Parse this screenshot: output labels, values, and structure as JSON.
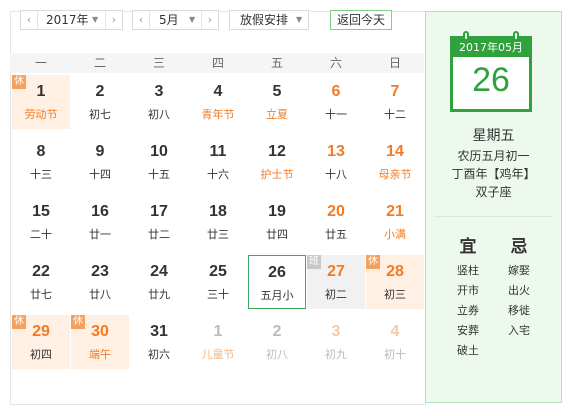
{
  "toolbar": {
    "year": "2017年",
    "month": "5月",
    "holiday_select": "放假安排",
    "today_button": "返回今天"
  },
  "weekdays": [
    "一",
    "二",
    "三",
    "四",
    "五",
    "六",
    "日"
  ],
  "days": [
    {
      "num": "1",
      "sub": "劳动节",
      "fest": true,
      "weekend": false,
      "holiday": true,
      "tag": "休"
    },
    {
      "num": "2",
      "sub": "初七"
    },
    {
      "num": "3",
      "sub": "初八"
    },
    {
      "num": "4",
      "sub": "青年节",
      "fest": true
    },
    {
      "num": "5",
      "sub": "立夏",
      "fest": true
    },
    {
      "num": "6",
      "sub": "十一",
      "weekend": true
    },
    {
      "num": "7",
      "sub": "十二",
      "weekend": true
    },
    {
      "num": "8",
      "sub": "十三"
    },
    {
      "num": "9",
      "sub": "十四"
    },
    {
      "num": "10",
      "sub": "十五"
    },
    {
      "num": "11",
      "sub": "十六"
    },
    {
      "num": "12",
      "sub": "护士节",
      "fest": true
    },
    {
      "num": "13",
      "sub": "十八",
      "weekend": true
    },
    {
      "num": "14",
      "sub": "母亲节",
      "fest": true,
      "weekend": true
    },
    {
      "num": "15",
      "sub": "二十"
    },
    {
      "num": "16",
      "sub": "廿一"
    },
    {
      "num": "17",
      "sub": "廿二"
    },
    {
      "num": "18",
      "sub": "廿三"
    },
    {
      "num": "19",
      "sub": "廿四"
    },
    {
      "num": "20",
      "sub": "廿五",
      "weekend": true
    },
    {
      "num": "21",
      "sub": "小满",
      "fest": true,
      "weekend": true
    },
    {
      "num": "22",
      "sub": "廿七"
    },
    {
      "num": "23",
      "sub": "廿八"
    },
    {
      "num": "24",
      "sub": "廿九"
    },
    {
      "num": "25",
      "sub": "三十"
    },
    {
      "num": "26",
      "sub": "五月小",
      "today": true
    },
    {
      "num": "27",
      "sub": "初二",
      "weekend": true,
      "workday": true,
      "tag": "班"
    },
    {
      "num": "28",
      "sub": "初三",
      "weekend": true,
      "holiday": true,
      "tag": "休"
    },
    {
      "num": "29",
      "sub": "初四",
      "weekend": true,
      "holiday": true,
      "tag": "休"
    },
    {
      "num": "30",
      "sub": "端午",
      "fest": true,
      "weekend": true,
      "holiday": true,
      "tag": "休"
    },
    {
      "num": "31",
      "sub": "初六"
    },
    {
      "num": "1",
      "sub": "儿童节",
      "fest": true,
      "other": true
    },
    {
      "num": "2",
      "sub": "初八",
      "other": true
    },
    {
      "num": "3",
      "sub": "初九",
      "other": true,
      "weekend": true
    },
    {
      "num": "4",
      "sub": "初十",
      "other": true,
      "weekend": true
    }
  ],
  "detail": {
    "page_header": "2017年05月",
    "page_day": "26",
    "weekday": "星期五",
    "lunar": "农历五月初一",
    "ganzhi": "丁酉年【鸡年】",
    "zodiac": "双子座",
    "yi_label": "宜",
    "ji_label": "忌",
    "yi": [
      "竖柱",
      "开市",
      "立券",
      "安葬",
      "破土"
    ],
    "ji": [
      "嫁娶",
      "出火",
      "移徙",
      "入宅"
    ]
  },
  "colors": {
    "accent_green": "#2fa23e",
    "festival_orange": "#f27b24",
    "holiday_bg": "#fff0e3"
  }
}
